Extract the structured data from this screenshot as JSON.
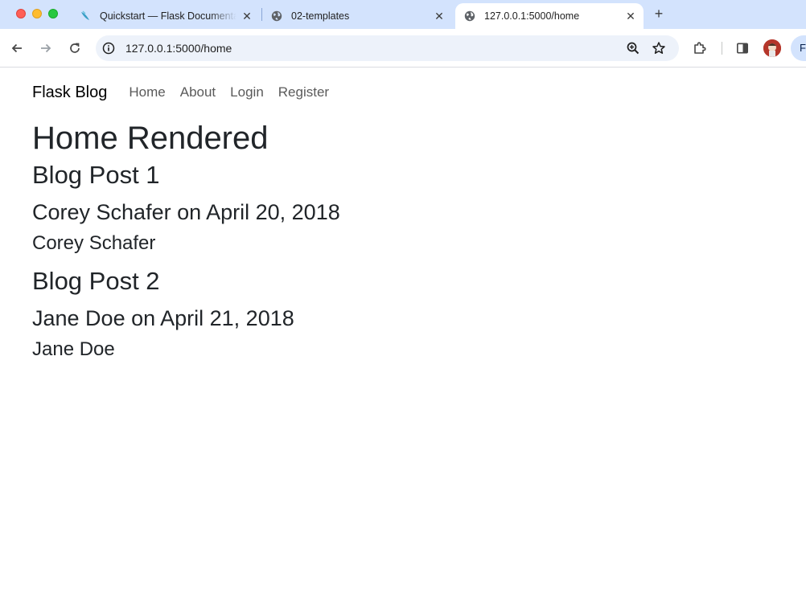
{
  "browser": {
    "tabs": [
      {
        "title": "Quickstart — Flask Documentation",
        "favicon": "flask-icon",
        "active": false
      },
      {
        "title": "02-templates",
        "favicon": "globe-icon",
        "active": false
      },
      {
        "title": "127.0.0.1:5000/home",
        "favicon": "globe-icon",
        "active": true
      }
    ],
    "new_tab": "+",
    "address": "127.0.0.1:5000/home",
    "profile_initial": "F",
    "colors": {
      "tabstrip": "#d3e3fd",
      "omnibox": "#edf2fa"
    }
  },
  "site": {
    "brand": "Flask Blog",
    "nav": [
      "Home",
      "About",
      "Login",
      "Register"
    ],
    "heading": "Home Rendered",
    "posts": [
      {
        "title": "Blog Post 1",
        "byline": "Corey Schafer on April 20, 2018",
        "author": "Corey Schafer"
      },
      {
        "title": "Blog Post 2",
        "byline": "Jane Doe on April 21, 2018",
        "author": "Jane Doe"
      }
    ]
  }
}
